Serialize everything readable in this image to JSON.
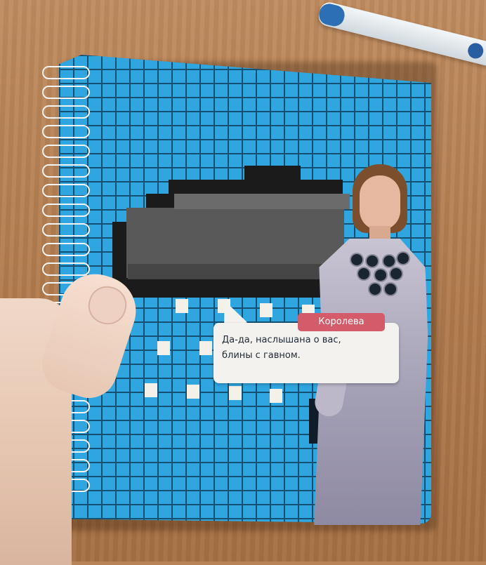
{
  "scene": {
    "background_color": "#b88356",
    "notebook_color": "#2fa6e0",
    "bubble": {
      "name_tag": "Королева",
      "lines": [
        "Да-да, наслышана о вас,",
        "блины с гавном."
      ],
      "tag_color": "#d45b6a"
    }
  }
}
